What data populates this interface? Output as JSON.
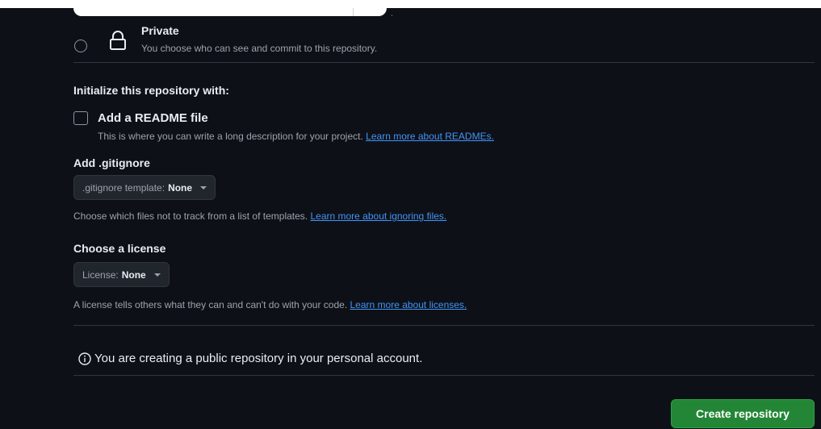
{
  "visibility": {
    "private_title": "Private",
    "private_description": "You choose who can see and commit to this repository."
  },
  "initialize": {
    "title": "Initialize this repository with:",
    "readme_label": "Add a README file",
    "readme_help": "This is where you can write a long description for your project.",
    "readme_link": "Learn more about READMEs."
  },
  "gitignore": {
    "title": "Add .gitignore",
    "select_prefix": ".gitignore template:",
    "select_value": "None",
    "help": "Choose which files not to track from a list of templates.",
    "link": "Learn more about ignoring files."
  },
  "license": {
    "title": "Choose a license",
    "select_prefix": "License:",
    "select_value": "None",
    "help": "A license tells others what they can and can't do with your code.",
    "link": "Learn more about licenses."
  },
  "notice": {
    "text": "You are creating a public repository in your personal account."
  },
  "actions": {
    "create_label": "Create repository"
  },
  "colors": {
    "background": "#0d1117",
    "link": "#4493f8",
    "primary_button": "#238636"
  },
  "icons": {
    "lock": "lock-icon",
    "info": "info-icon",
    "caret": "caret-down-icon"
  }
}
